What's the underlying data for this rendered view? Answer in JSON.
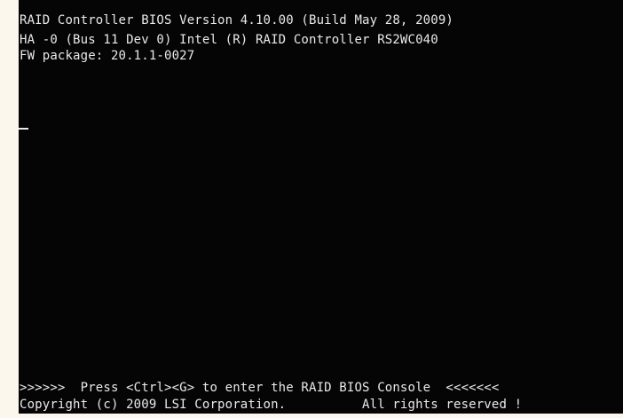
{
  "bios": {
    "header_line1": "RAID Controller BIOS Version 4.10.00 (Build May 28, 2009)",
    "header_line2": "HA -0 (Bus 11 Dev 0) Intel (R) RAID Controller RS2WC040",
    "header_line3": "FW package: 20.1.1-0027",
    "prompt_line": ">>>>>>  Press <Ctrl><G> to enter the RAID BIOS Console  <<<<<<<",
    "copyright_line": "Copyright (c) 2009 LSI Corporation.          All rights reserved !"
  },
  "colors": {
    "background": "#050505",
    "text": "#e9e9e9",
    "margin": "#fbf7ec"
  }
}
